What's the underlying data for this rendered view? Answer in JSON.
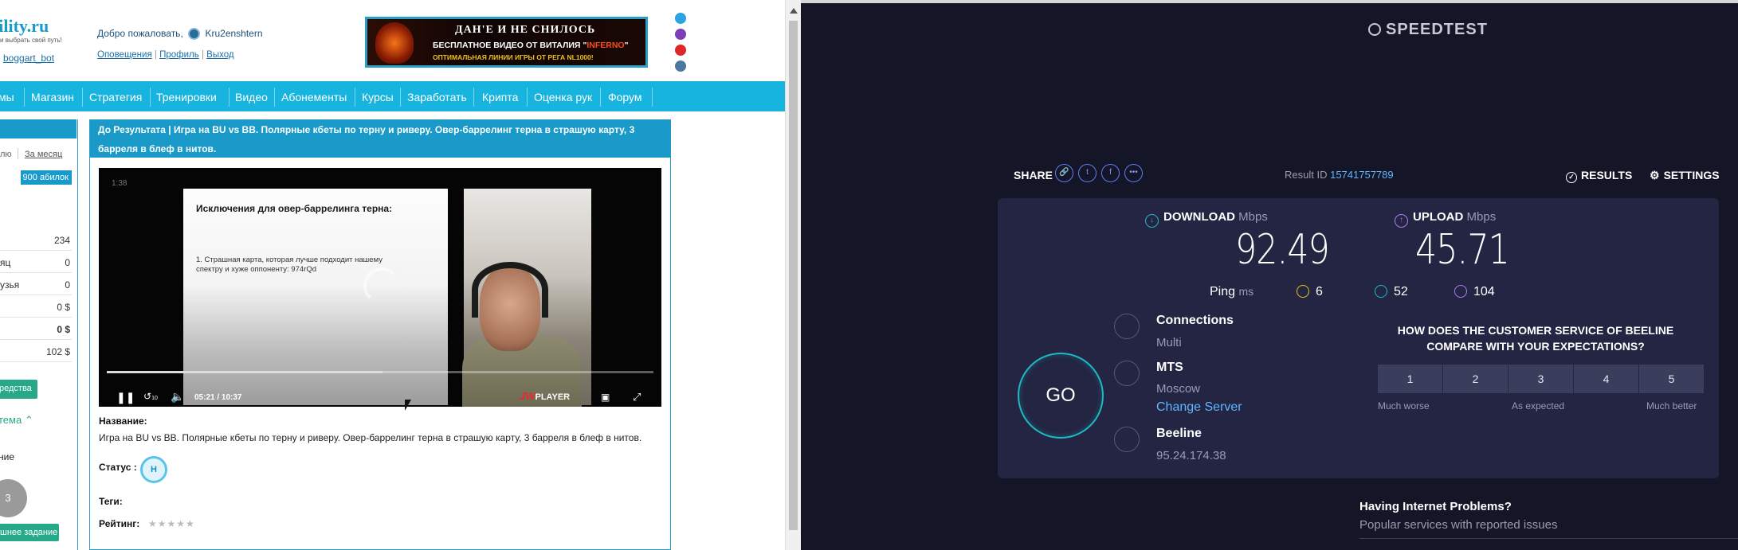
{
  "left": {
    "logo": "bility.ru",
    "logo_sub": "и выбрать свой путь!",
    "bot_link": "boggart_bot",
    "welcome": "Добро пожаловать,",
    "username": "Kru2enshtern",
    "links": {
      "alerts": "Оповещения",
      "profile": "Профиль",
      "exit": "Выход"
    },
    "banner": {
      "line1": "ДАН'Е И НЕ СНИЛОСЬ",
      "line2a": "БЕСПЛАТНОЕ ВИДЕО ОТ ВИТАЛИЯ \"",
      "line2b": "INFERNO",
      "line2c": "\"",
      "line3": "ОПТИМАЛЬНАЯ ЛИНИИ ИГРЫ ОТ РЕГА NL1000!"
    },
    "nav": [
      "мы",
      "Магазин",
      "Стратегия",
      "Тренировки",
      "Видео",
      "Абонементы",
      "Курсы",
      "Заработать",
      "Крипта",
      "Оценка рук",
      "Форум"
    ],
    "sidebar": {
      "link1": "лю",
      "link2": "За месяц",
      "badge": "900 абилок",
      "rows": [
        {
          "k": "",
          "v": "234"
        },
        {
          "k": "яц",
          "v": "0"
        },
        {
          "k": "узья",
          "v": "0"
        },
        {
          "k": "",
          "v": "0 $"
        },
        {
          "k": "",
          "v": "0 $"
        },
        {
          "k": "",
          "v": "102 $"
        }
      ],
      "btn_funds": "редства",
      "topic": "тема",
      "label_task": "ние",
      "circle": "3",
      "btn_task": "шнее задание"
    },
    "content": {
      "title": "До Результата | Игра на BU vs BB. Полярные кбеты по терну и риверу. Овер-баррелинг терна в страшую карту, 3 барреля в блеф в нитов.",
      "video": {
        "top_time": "1:38",
        "slide_title": "Исключения для овер-баррелинга терна:",
        "slide_text": "1. Страшная карта, которая лучше подходит нашему спектру и хуже оппоненту: 974rQd",
        "time_current": "05:21",
        "time_sep": "/",
        "time_total": "10:37",
        "progress": 0.505,
        "brand": "JW",
        "brand2": "PLAYER",
        "skip_label": "10"
      },
      "name_label": "Название:",
      "name_value": "Игра на BU vs BB. Полярные кбеты по терну и риверу. Овер-баррелинг терна в страшую карту, 3 барреля в блеф в нитов.",
      "status_label": "Статус :",
      "status_value": "Н",
      "tags_label": "Теги:",
      "rating_label": "Рейтинг:",
      "rating_stars": "★★★★★"
    }
  },
  "speedtest": {
    "logo": "SPEEDTEST",
    "share": "SHARE",
    "result_label": "Result ID",
    "result_id": "15741757789",
    "results": "RESULTS",
    "settings": "SETTINGS",
    "download_label": "DOWNLOAD",
    "upload_label": "UPLOAD",
    "unit": "Mbps",
    "download": "92.49",
    "upload": "45.71",
    "ping_label": "Ping",
    "ping_unit": "ms",
    "ping": "6",
    "ping_down": "52",
    "ping_up": "104",
    "go": "GO",
    "connections_label": "Connections",
    "connections_value": "Multi",
    "server_name": "MTS",
    "server_city": "Moscow",
    "change_server": "Change Server",
    "isp": "Beeline",
    "ip": "95.24.174.38",
    "question": "HOW DOES THE CUSTOMER SERVICE OF BEELINE COMPARE WITH YOUR EXPECTATIONS?",
    "ratings": [
      "1",
      "2",
      "3",
      "4",
      "5"
    ],
    "rate_labels": {
      "low": "Much worse",
      "mid": "As expected",
      "high": "Much better"
    },
    "help_title": "Having Internet Problems?",
    "help_sub": "Popular services with reported issues"
  },
  "colors": {
    "accent": "#18b4e0",
    "speedtest_bg": "#141526",
    "go_ring": "#1fb9c4",
    "download": "#1fb9c4",
    "upload": "#b07cf5"
  }
}
